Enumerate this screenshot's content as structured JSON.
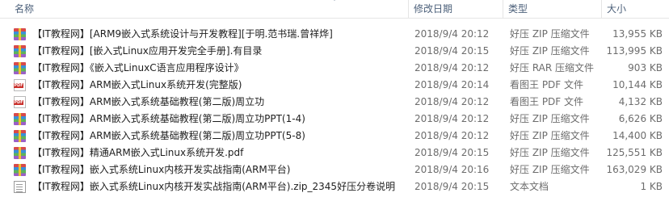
{
  "columns": {
    "name": "名称",
    "date": "修改日期",
    "type": "类型",
    "size": "大小"
  },
  "files": [
    {
      "icon": "archive-icon",
      "name": "【IT教程网】[ARM9嵌入式系统设计与开发教程][于明.范书瑞.曾祥烨]",
      "date": "2018/9/4 20:12",
      "type": "好压 ZIP 压缩文件",
      "size": "13,955 KB"
    },
    {
      "icon": "archive-icon",
      "name": "【IT教程网】[嵌入式Linux应用开发完全手册].有目录",
      "date": "2018/9/4 20:15",
      "type": "好压 ZIP 压缩文件",
      "size": "113,995 KB"
    },
    {
      "icon": "archive-icon",
      "name": "【IT教程网】《嵌入式LinuxC语言应用程序设计》",
      "date": "2018/9/4 20:12",
      "type": "好压 RAR 压缩文件",
      "size": "903 KB"
    },
    {
      "icon": "pdf-icon",
      "name": "【IT教程网】ARM嵌入式Linux系统开发(完整版)",
      "date": "2018/9/4 20:14",
      "type": "看图王 PDF 文件",
      "size": "10,144 KB"
    },
    {
      "icon": "pdf-icon",
      "name": "【IT教程网】ARM嵌入式系统基础教程(第二版)周立功",
      "date": "2018/9/4 20:12",
      "type": "看图王 PDF 文件",
      "size": "4,132 KB"
    },
    {
      "icon": "archive-icon",
      "name": "【IT教程网】ARM嵌入式系统基础教程(第二版)周立功PPT(1-4)",
      "date": "2018/9/4 20:12",
      "type": "好压 ZIP 压缩文件",
      "size": "6,626 KB"
    },
    {
      "icon": "archive-icon",
      "name": "【IT教程网】ARM嵌入式系统基础教程(第二版)周立功PPT(5-8)",
      "date": "2018/9/4 20:12",
      "type": "好压 ZIP 压缩文件",
      "size": "14,400 KB"
    },
    {
      "icon": "archive-icon",
      "name": "【IT教程网】精通ARM嵌入式Linux系统开发.pdf",
      "date": "2018/9/4 20:15",
      "type": "好压 ZIP 压缩文件",
      "size": "125,551 KB"
    },
    {
      "icon": "archive-icon",
      "name": "【IT教程网】嵌入式系统Linux内核开发实战指南(ARM平台)",
      "date": "2018/9/4 20:16",
      "type": "好压 ZIP 压缩文件",
      "size": "163,029 KB"
    },
    {
      "icon": "text-file-icon",
      "name": "【IT教程网】嵌入式系统Linux内核开发实战指南(ARM平台).zip_2345好压分卷说明",
      "date": "2018/9/4 20:15",
      "type": "文本文档",
      "size": "1 KB"
    }
  ]
}
